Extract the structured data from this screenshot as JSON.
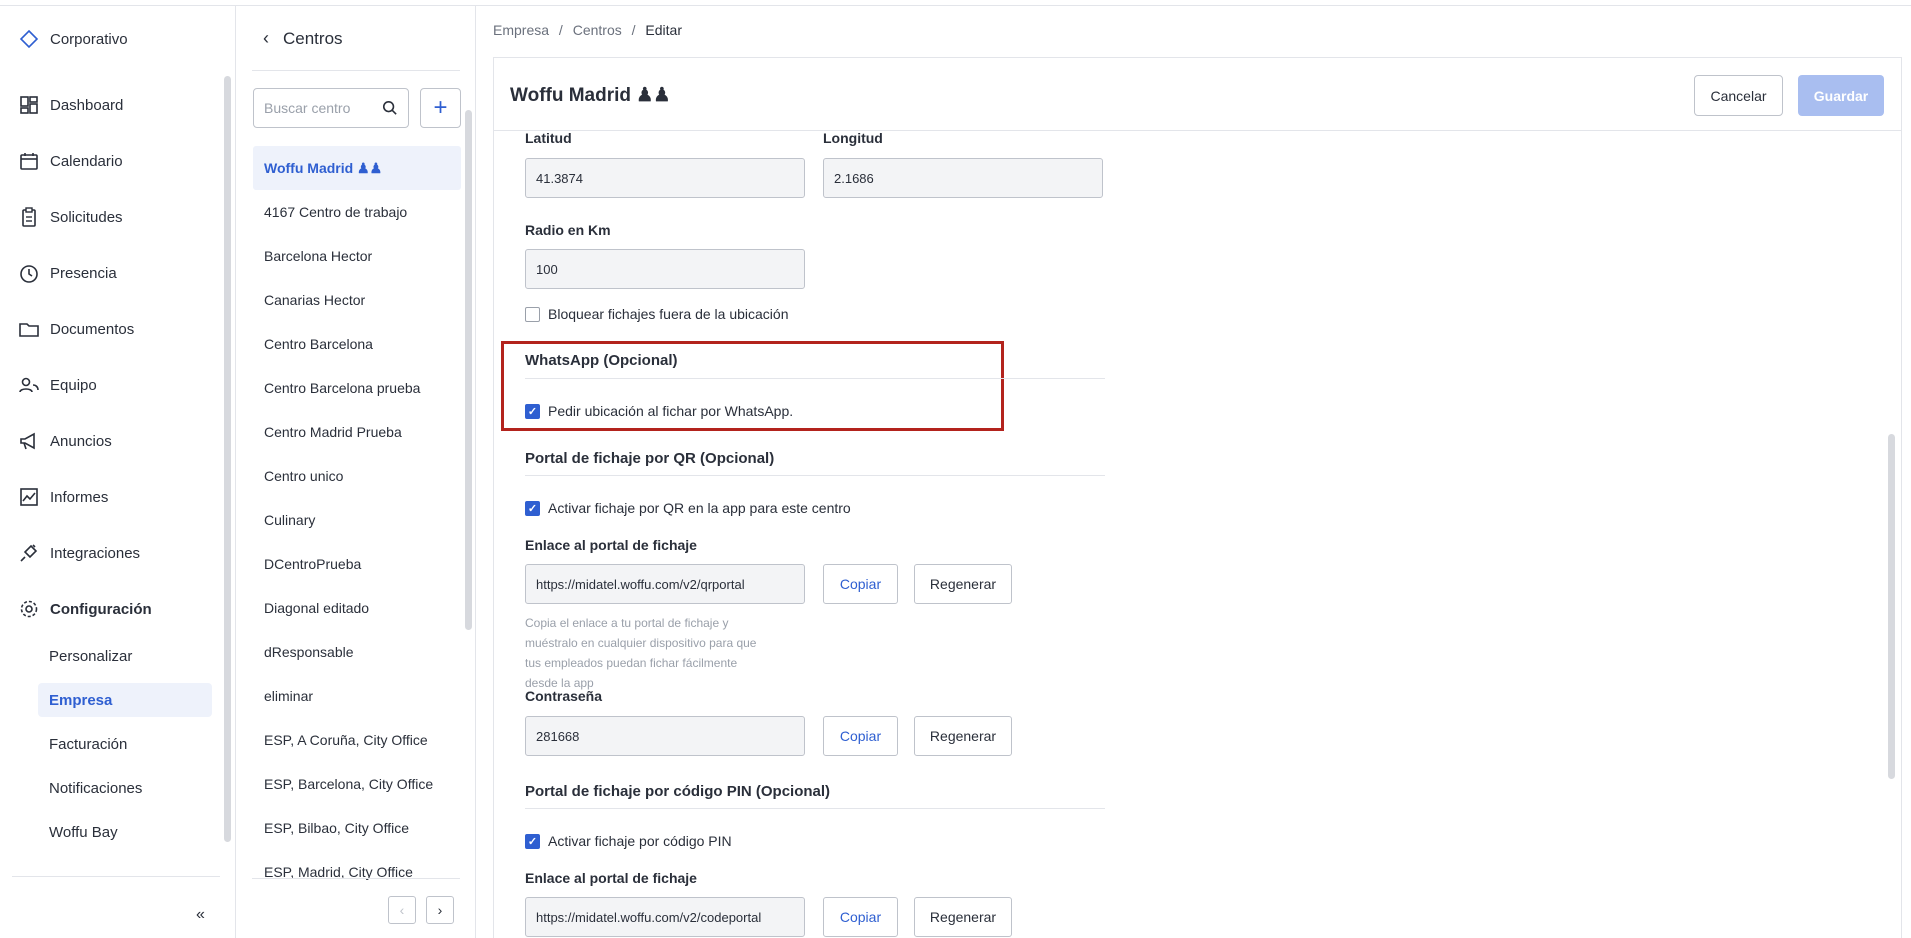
{
  "brand": {
    "label": "Corporativo"
  },
  "nav": {
    "items": [
      {
        "label": "Dashboard",
        "icon": "dashboard-icon"
      },
      {
        "label": "Calendario",
        "icon": "calendar-icon"
      },
      {
        "label": "Solicitudes",
        "icon": "clipboard-icon"
      },
      {
        "label": "Presencia",
        "icon": "clock-icon"
      },
      {
        "label": "Documentos",
        "icon": "folder-icon"
      },
      {
        "label": "Equipo",
        "icon": "users-icon"
      },
      {
        "label": "Anuncios",
        "icon": "megaphone-icon"
      },
      {
        "label": "Informes",
        "icon": "chart-icon"
      },
      {
        "label": "Integraciones",
        "icon": "plug-icon"
      },
      {
        "label": "Configuración",
        "icon": "gear-icon"
      }
    ],
    "sub_items": [
      "Personalizar",
      "Empresa",
      "Facturación",
      "Notificaciones",
      "Woffu Bay"
    ],
    "collapse": "«"
  },
  "centers": {
    "title": "Centros",
    "search_placeholder": "Buscar centro",
    "add_label": "+",
    "items": [
      "Woffu Madrid ♟♟",
      "4167 Centro de trabajo",
      "Barcelona Hector",
      "Canarias Hector",
      "Centro Barcelona",
      "Centro Barcelona prueba",
      "Centro Madrid Prueba",
      "Centro unico",
      "Culinary",
      "DCentroPrueba",
      "Diagonal editado",
      "dResponsable",
      "eliminar",
      "ESP, A Coruña, City Office",
      "ESP, Barcelona, City Office",
      "ESP, Bilbao, City Office",
      "ESP, Madrid, City Office"
    ],
    "prev": "‹",
    "next": "›"
  },
  "breadcrumb": {
    "items": [
      "Empresa",
      "Centros",
      "Editar"
    ],
    "separator": "/"
  },
  "editor": {
    "title": "Woffu Madrid ♟♟",
    "cancel": "Cancelar",
    "save": "Guardar",
    "lat_label": "Latitud",
    "lat_value": "41.3874",
    "lng_label": "Longitud",
    "lng_value": "2.1686",
    "radius_label": "Radio en Km",
    "radius_value": "100",
    "block_label": "Bloquear fichajes fuera de la ubicación",
    "block_checked": false,
    "whatsapp_title": "WhatsApp (Opcional)",
    "whatsapp_check": "Pedir ubicación al fichar por WhatsApp.",
    "qr_title": "Portal de fichaje por QR (Opcional)",
    "qr_check": "Activar fichaje por QR en la app para este centro",
    "qr_link_label": "Enlace al portal de fichaje",
    "qr_link_value": "https://midatel.woffu.com/v2/qrportal",
    "copy": "Copiar",
    "regen": "Regenerar",
    "qr_help": "Copia el enlace a tu portal de fichaje y muéstralo en cualquier dispositivo para que tus empleados puedan fichar fácilmente desde la app",
    "password_label": "Contraseña",
    "password_value": "281668",
    "pin_title": "Portal de fichaje por código PIN (Opcional)",
    "pin_check": "Activar fichaje por código PIN",
    "pin_link_label": "Enlace al portal de fichaje",
    "pin_link_value": "https://midatel.woffu.com/v2/codeportal"
  },
  "colors": {
    "accent": "#2f5fd1",
    "highlight": "#b3231d",
    "save_disabled": "#a9bef0"
  }
}
